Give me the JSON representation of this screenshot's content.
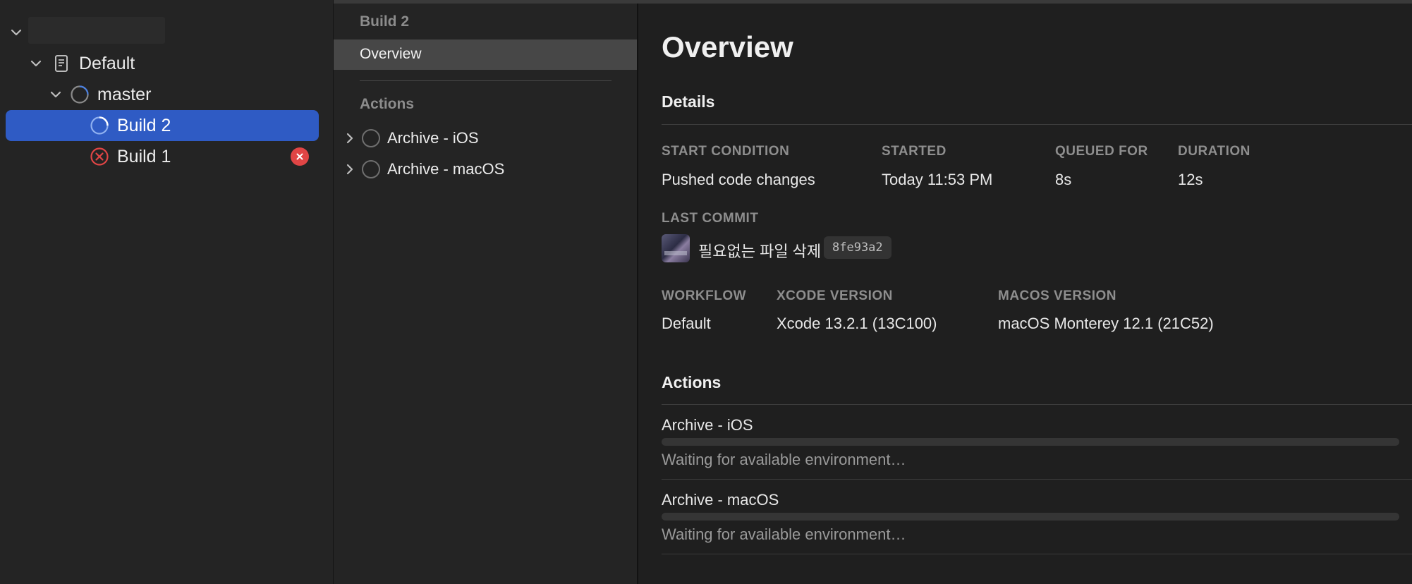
{
  "navigator": {
    "items": [
      {
        "label": "Default",
        "icon": "document-icon"
      },
      {
        "label": "master",
        "icon": "branch-status-icon"
      },
      {
        "label": "Build 2",
        "icon": "in-progress-icon",
        "selected": true
      },
      {
        "label": "Build 1",
        "icon": "error-icon",
        "badge": "error"
      }
    ]
  },
  "sidebar": {
    "title": "Build 2",
    "selected": "Overview",
    "section": "Actions",
    "actions": [
      "Archive - iOS",
      "Archive - macOS"
    ]
  },
  "main": {
    "title": "Overview",
    "details_heading": "Details",
    "start_condition": {
      "label": "START CONDITION",
      "value": "Pushed code changes"
    },
    "started": {
      "label": "STARTED",
      "value": "Today 11:53 PM"
    },
    "queued_for": {
      "label": "QUEUED FOR",
      "value": "8s"
    },
    "duration": {
      "label": "DURATION",
      "value": "12s"
    },
    "last_commit": {
      "label": "LAST COMMIT",
      "message": "필요없는 파일 삭제",
      "hash": "8fe93a2"
    },
    "workflow": {
      "label": "WORKFLOW",
      "value": "Default"
    },
    "xcode_version": {
      "label": "XCODE VERSION",
      "value": "Xcode 13.2.1 (13C100)"
    },
    "macos_version": {
      "label": "MACOS VERSION",
      "value": "macOS Monterey 12.1 (21C52)"
    },
    "actions_heading": "Actions",
    "actions": [
      {
        "name": "Archive - iOS",
        "status": "Waiting for available environment…",
        "progress": 0
      },
      {
        "name": "Archive - macOS",
        "status": "Waiting for available environment…",
        "progress": 0
      }
    ]
  },
  "colors": {
    "selection": "#2f5bc4",
    "error": "#e04545",
    "spinner": "#4a7fe0"
  }
}
